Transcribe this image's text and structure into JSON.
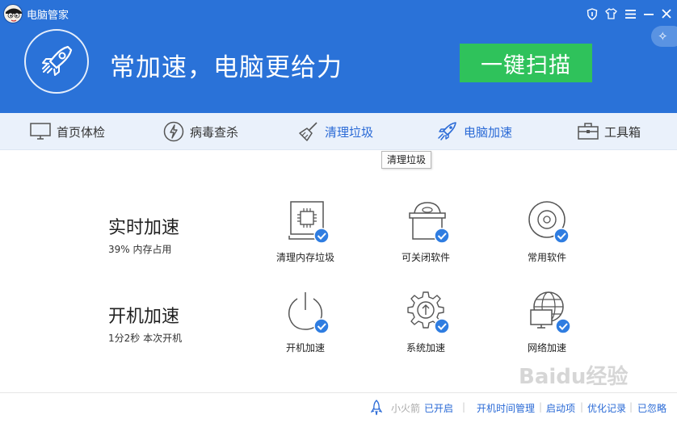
{
  "app": {
    "title": "电脑管家"
  },
  "window_controls": {
    "shield": "shield-icon",
    "skin": "shirt-icon",
    "menu": "menu-icon",
    "minimize": "minimize-icon",
    "close": "close-icon"
  },
  "header": {
    "slogan": "常加速，电脑更给力",
    "scan_button": "一键扫描"
  },
  "nav": {
    "items": [
      {
        "label": "首页体检",
        "icon": "monitor-icon"
      },
      {
        "label": "病毒查杀",
        "icon": "lightning-icon"
      },
      {
        "label": "清理垃圾",
        "icon": "broom-icon"
      },
      {
        "label": "电脑加速",
        "icon": "rocket-icon"
      },
      {
        "label": "工具箱",
        "icon": "toolbox-icon"
      }
    ],
    "tooltip": "清理垃圾"
  },
  "sections": {
    "realtime": {
      "title": "实时加速",
      "subtitle": "39% 内存占用",
      "features": [
        {
          "label": "清理内存垃圾",
          "icon": "memory-chip-icon"
        },
        {
          "label": "可关闭软件",
          "icon": "box-disc-icon"
        },
        {
          "label": "常用软件",
          "icon": "disc-icon"
        }
      ]
    },
    "boot": {
      "title": "开机加速",
      "subtitle": "1分2秒 本次开机",
      "features": [
        {
          "label": "开机加速",
          "icon": "power-icon"
        },
        {
          "label": "系统加速",
          "icon": "gear-icon"
        },
        {
          "label": "网络加速",
          "icon": "network-globe-icon"
        }
      ]
    }
  },
  "footer": {
    "rocket_label": "小火箭",
    "rocket_status": "已开启",
    "links": [
      "开机时间管理",
      "启动项",
      "优化记录",
      "已忽略"
    ]
  },
  "watermark": "Baidu经验",
  "colors": {
    "header_blue": "#2a72d8",
    "scan_green": "#2fc25b",
    "link_blue": "#2a6ad6",
    "check_blue": "#2f7de1"
  }
}
